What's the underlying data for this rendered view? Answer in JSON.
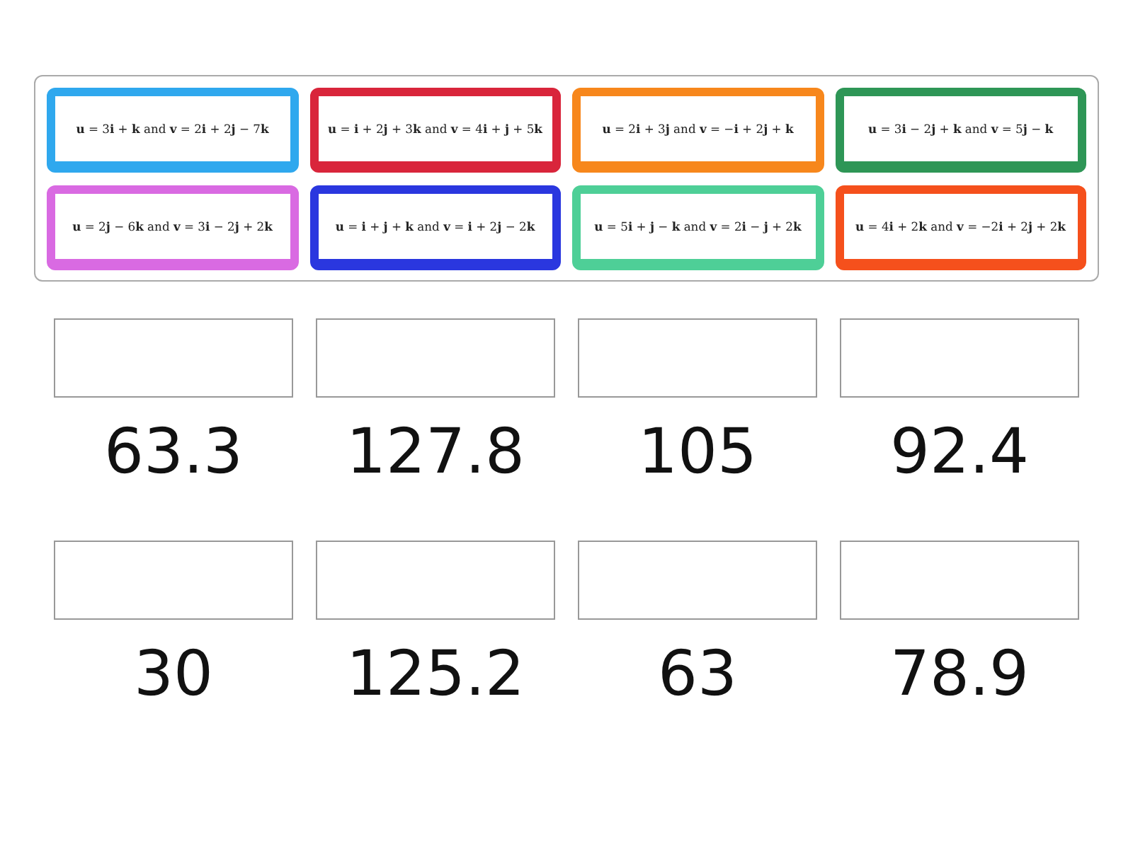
{
  "cards": [
    {
      "text": "**u** = 3**i** + **k** and **v** = 2**i** + 2**j** − 7**k**",
      "color": "#2fa8ee"
    },
    {
      "text": "**u** = **i** + 2**j** + 3**k** and **v** = 4**i** + **j** + 5**k**",
      "color": "#d9253b"
    },
    {
      "text": "**u** = 2**i** + 3**j** and **v** = −**i** + 2**j** + **k**",
      "color": "#f7871c"
    },
    {
      "text": "**u** = 3**i** − 2**j** + **k** and **v** = 5**j** − **k**",
      "color": "#2e9656"
    },
    {
      "text": "**u** = 2**j** − 6**k** and **v** = 3**i** − 2**j** + 2**k**",
      "color": "#d96ae2"
    },
    {
      "text": "**u** = **i** + **j** + **k** and **v** = **i** + 2**j** − 2**k**",
      "color": "#2a37df"
    },
    {
      "text": "**u** = 5**i** + **j** − **k** and **v** = 2**i** − **j** + 2**k**",
      "color": "#4ecf97"
    },
    {
      "text": "**u** = 4**i** + 2**k** and **v** = −2**i** + 2**j** + 2**k**",
      "color": "#f5501c"
    }
  ],
  "answers": [
    {
      "label": "63.3"
    },
    {
      "label": "127.8"
    },
    {
      "label": "105"
    },
    {
      "label": "92.4"
    },
    {
      "label": "30"
    },
    {
      "label": "125.2"
    },
    {
      "label": "63"
    },
    {
      "label": "78.9"
    }
  ]
}
